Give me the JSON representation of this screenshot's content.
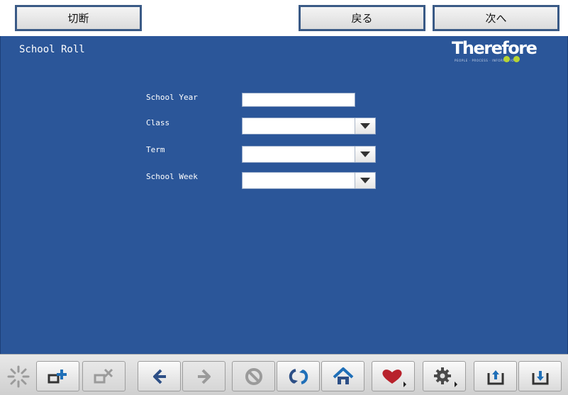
{
  "topbar": {
    "disconnect_label": "切断",
    "back_label": "戻る",
    "next_label": "次へ"
  },
  "main": {
    "title": "School Roll",
    "logo": {
      "name": "Therefore",
      "tagline": "PEOPLE · PROCESS · INFORMATION"
    },
    "fields": {
      "school_year": {
        "label": "School Year",
        "value": ""
      },
      "class": {
        "label": "Class",
        "value": ""
      },
      "term": {
        "label": "Term",
        "value": ""
      },
      "school_week": {
        "label": "School Week",
        "value": ""
      }
    }
  },
  "colors": {
    "panel_background": "#2b5699",
    "logo_accent": "#b5d334",
    "toolbar_blue": "#1f6fb8",
    "favorites_red": "#b8222c"
  },
  "toolbar": {
    "buttons": [
      {
        "icon": "loading-spinner-icon"
      },
      {
        "icon": "add-window-icon"
      },
      {
        "icon": "close-window-icon",
        "state": "disabled"
      },
      {
        "icon": "arrow-back-icon"
      },
      {
        "icon": "arrow-forward-icon",
        "state": "disabled"
      },
      {
        "icon": "stop-icon",
        "state": "disabled"
      },
      {
        "icon": "refresh-icon"
      },
      {
        "icon": "home-icon"
      },
      {
        "icon": "heart-icon"
      },
      {
        "icon": "gear-icon"
      },
      {
        "icon": "scroll-up-icon"
      },
      {
        "icon": "scroll-down-icon"
      }
    ]
  }
}
